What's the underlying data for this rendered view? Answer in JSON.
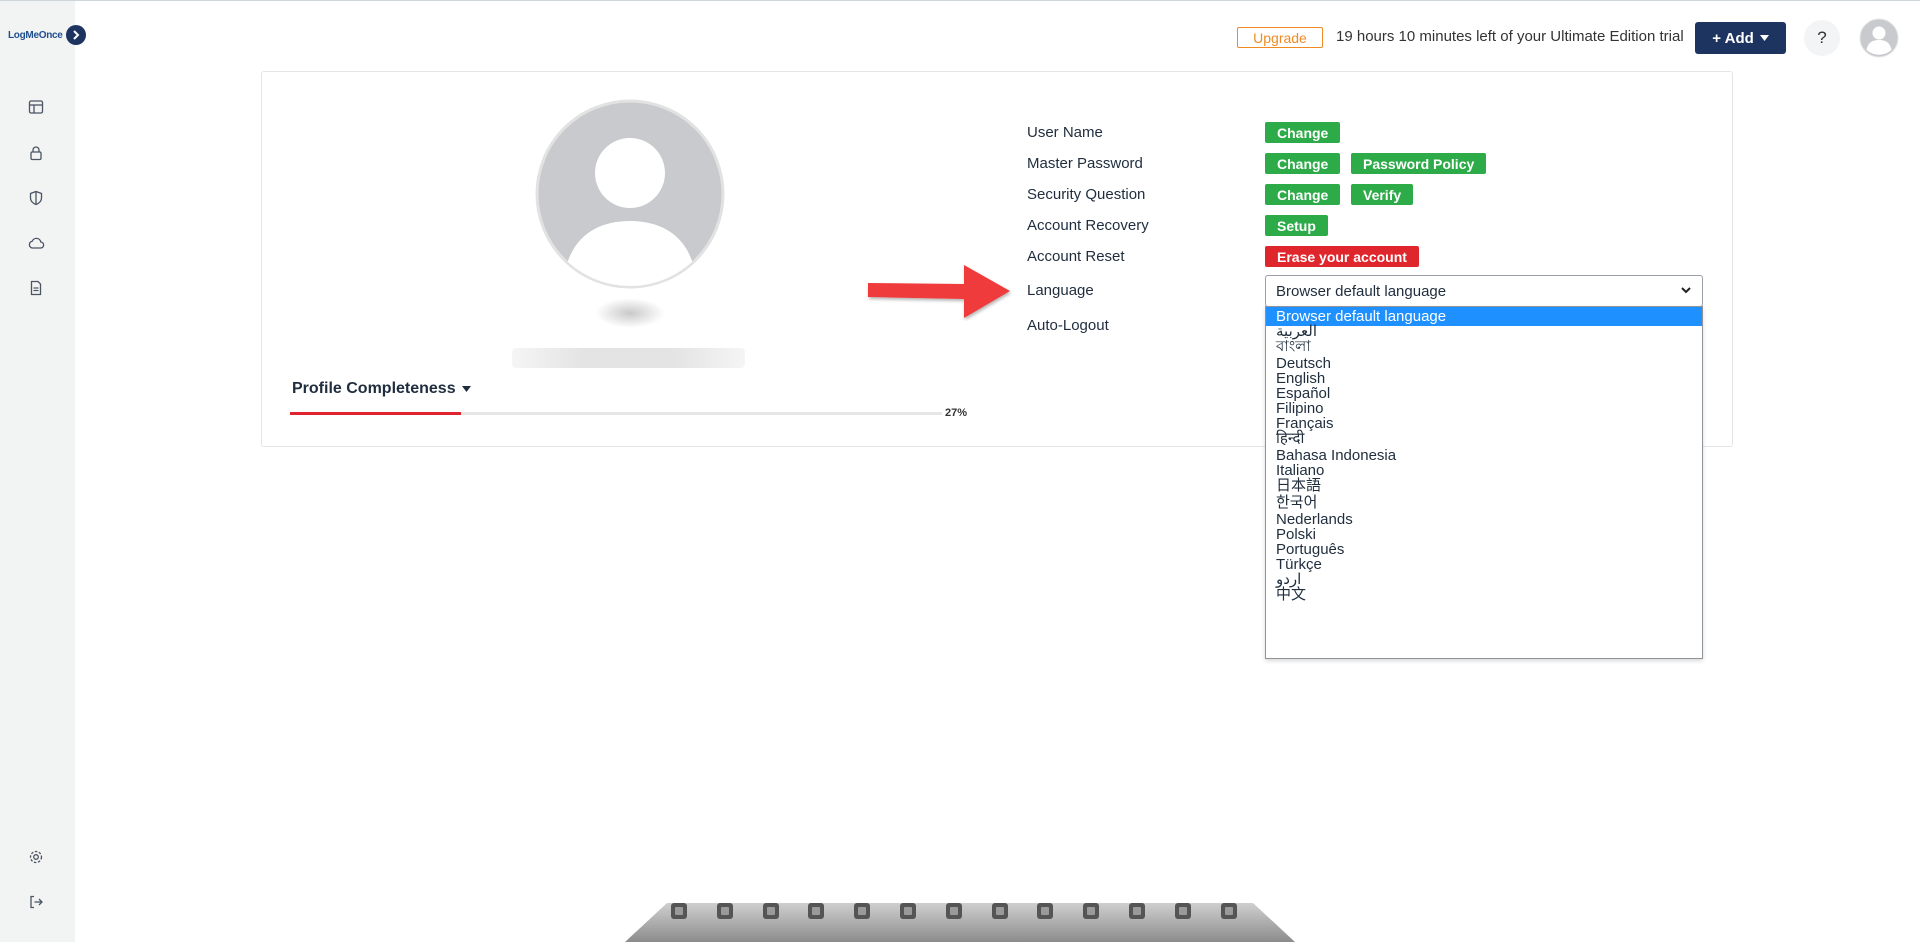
{
  "app": {
    "logo_text": "LogMeOnce"
  },
  "header": {
    "upgrade_label": "Upgrade",
    "trial_text": "19 hours 10 minutes left of your Ultimate Edition trial",
    "add_label": "+ Add",
    "help_label": "?"
  },
  "sidebar": {
    "items": [
      {
        "icon": "dashboard-icon"
      },
      {
        "icon": "lock-icon"
      },
      {
        "icon": "shield-icon"
      },
      {
        "icon": "cloud-icon"
      },
      {
        "icon": "document-icon"
      }
    ],
    "bottom": [
      {
        "icon": "gear-icon"
      },
      {
        "icon": "logout-icon"
      }
    ]
  },
  "profile": {
    "completeness_label": "Profile Completeness",
    "completeness_percent": 27,
    "completeness_text": "27%"
  },
  "settings": {
    "user_name": {
      "label": "User Name",
      "change": "Change"
    },
    "master_password": {
      "label": "Master Password",
      "change": "Change",
      "policy": "Password Policy"
    },
    "security_question": {
      "label": "Security Question",
      "change": "Change",
      "verify": "Verify"
    },
    "account_recovery": {
      "label": "Account Recovery",
      "setup": "Setup"
    },
    "account_reset": {
      "label": "Account Reset",
      "erase": "Erase your account"
    },
    "language": {
      "label": "Language",
      "selected": "Browser default language"
    },
    "auto_logout": {
      "label": "Auto-Logout"
    }
  },
  "language_options": [
    "Browser default language",
    "العربية",
    "বাংলা",
    "Deutsch",
    "English",
    "Español",
    "Filipino",
    "Français",
    "हिन्दी",
    "Bahasa Indonesia",
    "Italiano",
    "日本語",
    "한국어",
    "Nederlands",
    "Polski",
    "Português",
    "Türkçe",
    "اردو",
    "中文"
  ],
  "dock": {
    "icons": [
      "download-icon",
      "security-shield-icon",
      "wallet-icon",
      "identity-icon",
      "family-icon",
      "report-chart-icon",
      "notes-icon",
      "photo-icon",
      "cloud-storage-icon",
      "vault-icon",
      "devices-icon",
      "settings-gear-icon",
      "training-icon"
    ]
  },
  "colors": {
    "brand_navy": "#1d3461",
    "success_green": "#2eab49",
    "danger_red": "#e0262d",
    "upgrade_orange": "#f08a24",
    "progress_red": "#e0242f",
    "selected_option": "#1e90ff"
  }
}
